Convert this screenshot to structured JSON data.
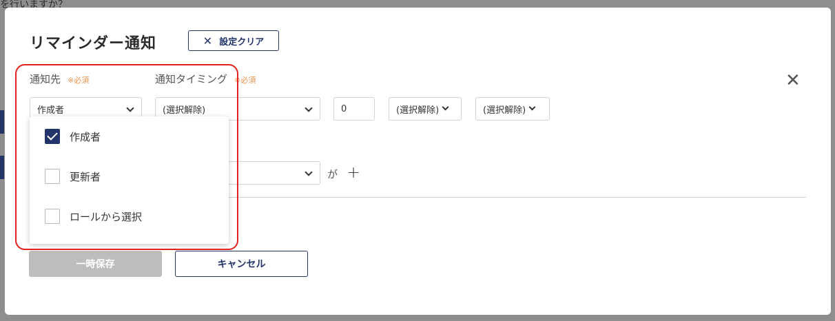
{
  "backdrop": {
    "top_text": "を行いますか？"
  },
  "modal": {
    "title": "リマインダー通知",
    "clear_button_label": "設定クリア",
    "close_icon": "close-icon"
  },
  "fields": {
    "recipient_label": "通知先",
    "recipient_required": "※必須",
    "recipient_value": "作成者",
    "timing_label": "通知タイミング",
    "timing_required": "※必須",
    "timing_value": "(選択解除)",
    "offset_value": "0",
    "unit_value": "(選択解除)",
    "relation_value": "(選択解除)",
    "ga_text": "が",
    "plus_icon": "plus-icon"
  },
  "dropdown": {
    "items": [
      {
        "label": "作成者",
        "checked": true
      },
      {
        "label": "更新者",
        "checked": false
      },
      {
        "label": "ロールから選択",
        "checked": false
      }
    ]
  },
  "actions": {
    "save_label": "一時保存",
    "cancel_label": "キャンセル"
  },
  "colors": {
    "accent": "#23346b",
    "required": "#f0934b",
    "highlight": "#e0201e",
    "disabled": "#bdbdbd"
  }
}
